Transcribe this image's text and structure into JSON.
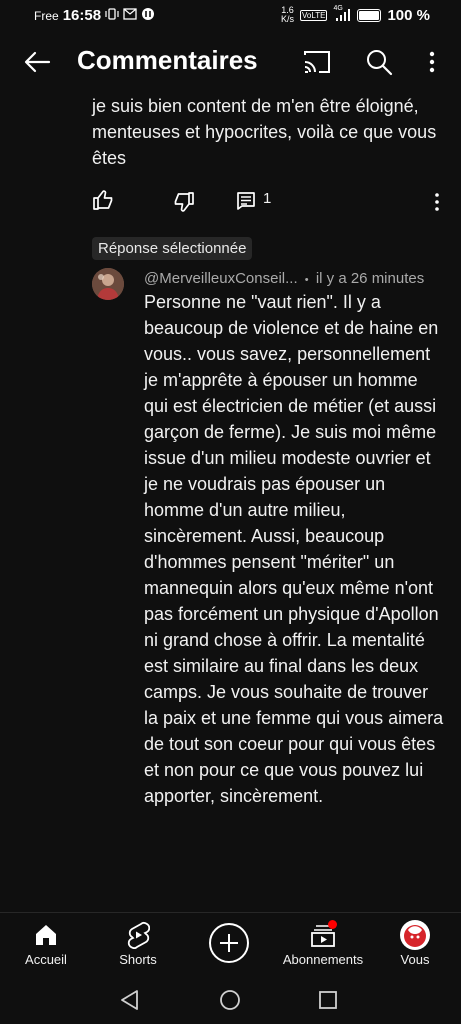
{
  "status_bar": {
    "carrier": "Free",
    "time": "16:58",
    "speed_value": "1.6",
    "speed_unit": "K/s",
    "volte": "VoLTE",
    "network": "4G",
    "battery": "100 %"
  },
  "app_bar": {
    "title": "Commentaires"
  },
  "parent_comment": {
    "text": "je suis bien content de m'en être éloigné, menteuses et hypocrites, voilà ce que vous êtes",
    "reply_count": "1"
  },
  "selected_badge": "Réponse sélectionnée",
  "reply": {
    "author": "@MerveilleuxConseil...",
    "separator": "•",
    "time": "il y a 26 minutes",
    "text": "Personne ne \"vaut rien\". Il y a beaucoup de violence et de haine en vous.. vous savez, personnellement je m'apprête à épouser un homme qui est électricien de métier (et aussi garçon de ferme). Je suis moi même issue d'un milieu modeste ouvrier et je ne voudrais pas épouser un homme d'un autre milieu, sincèrement. Aussi, beaucoup d'hommes pensent \"mériter\" un mannequin alors qu'eux même n'ont pas forcément un physique d'Apollon ni grand chose à offrir. La mentalité est similaire au final dans les deux camps. Je vous souhaite de trouver la paix et une femme qui vous aimera de tout son coeur pour qui vous êtes et non pour ce que vous pouvez lui apporter, sincèrement."
  },
  "bottom_nav": {
    "home": "Accueil",
    "shorts": "Shorts",
    "subscriptions": "Abonnements",
    "you": "Vous"
  },
  "colors": {
    "background": "#0f0f0f",
    "text": "#f1f1f1",
    "secondary_text": "#aaaaaa",
    "badge_bg": "#272727",
    "notification": "#ff0000"
  }
}
